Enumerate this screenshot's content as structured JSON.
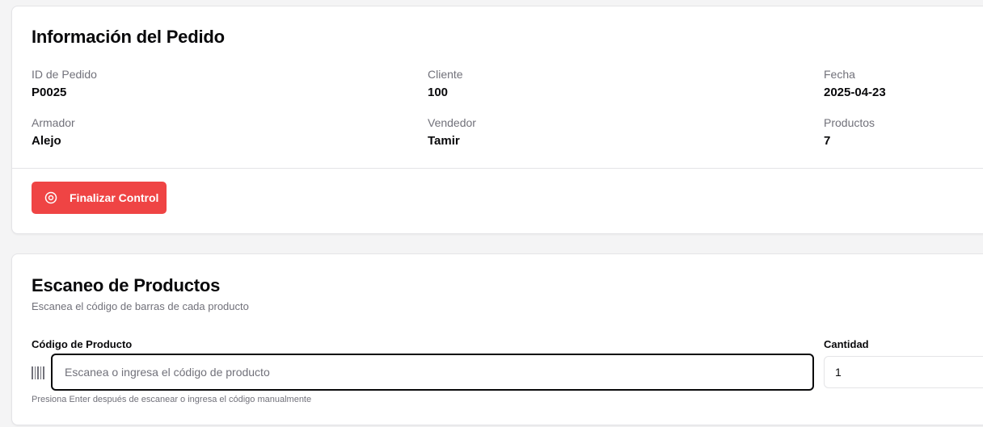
{
  "order_info": {
    "title": "Información del Pedido",
    "fields": [
      {
        "label": "ID de Pedido",
        "value": "P0025"
      },
      {
        "label": "Cliente",
        "value": "100"
      },
      {
        "label": "Fecha",
        "value": "2025-04-23"
      },
      {
        "label": "Armador",
        "value": "Alejo"
      },
      {
        "label": "Vendedor",
        "value": "Tamir"
      },
      {
        "label": "Productos",
        "value": "7"
      }
    ],
    "finish_button": {
      "label": "Finalizar Control",
      "icon": "stop-circle-icon"
    },
    "accent_color": "#ef4444"
  },
  "scan": {
    "title": "Escaneo de Productos",
    "subtitle": "Escanea el código de barras de cada producto",
    "code_label": "Código de Producto",
    "code_placeholder": "Escanea o ingresa el código de producto",
    "code_value": "",
    "barcode_icon": "barcode-icon",
    "quantity_label": "Cantidad",
    "quantity_value": "1",
    "hint": "Presiona Enter después de escanear o ingresa el código manualmente"
  }
}
